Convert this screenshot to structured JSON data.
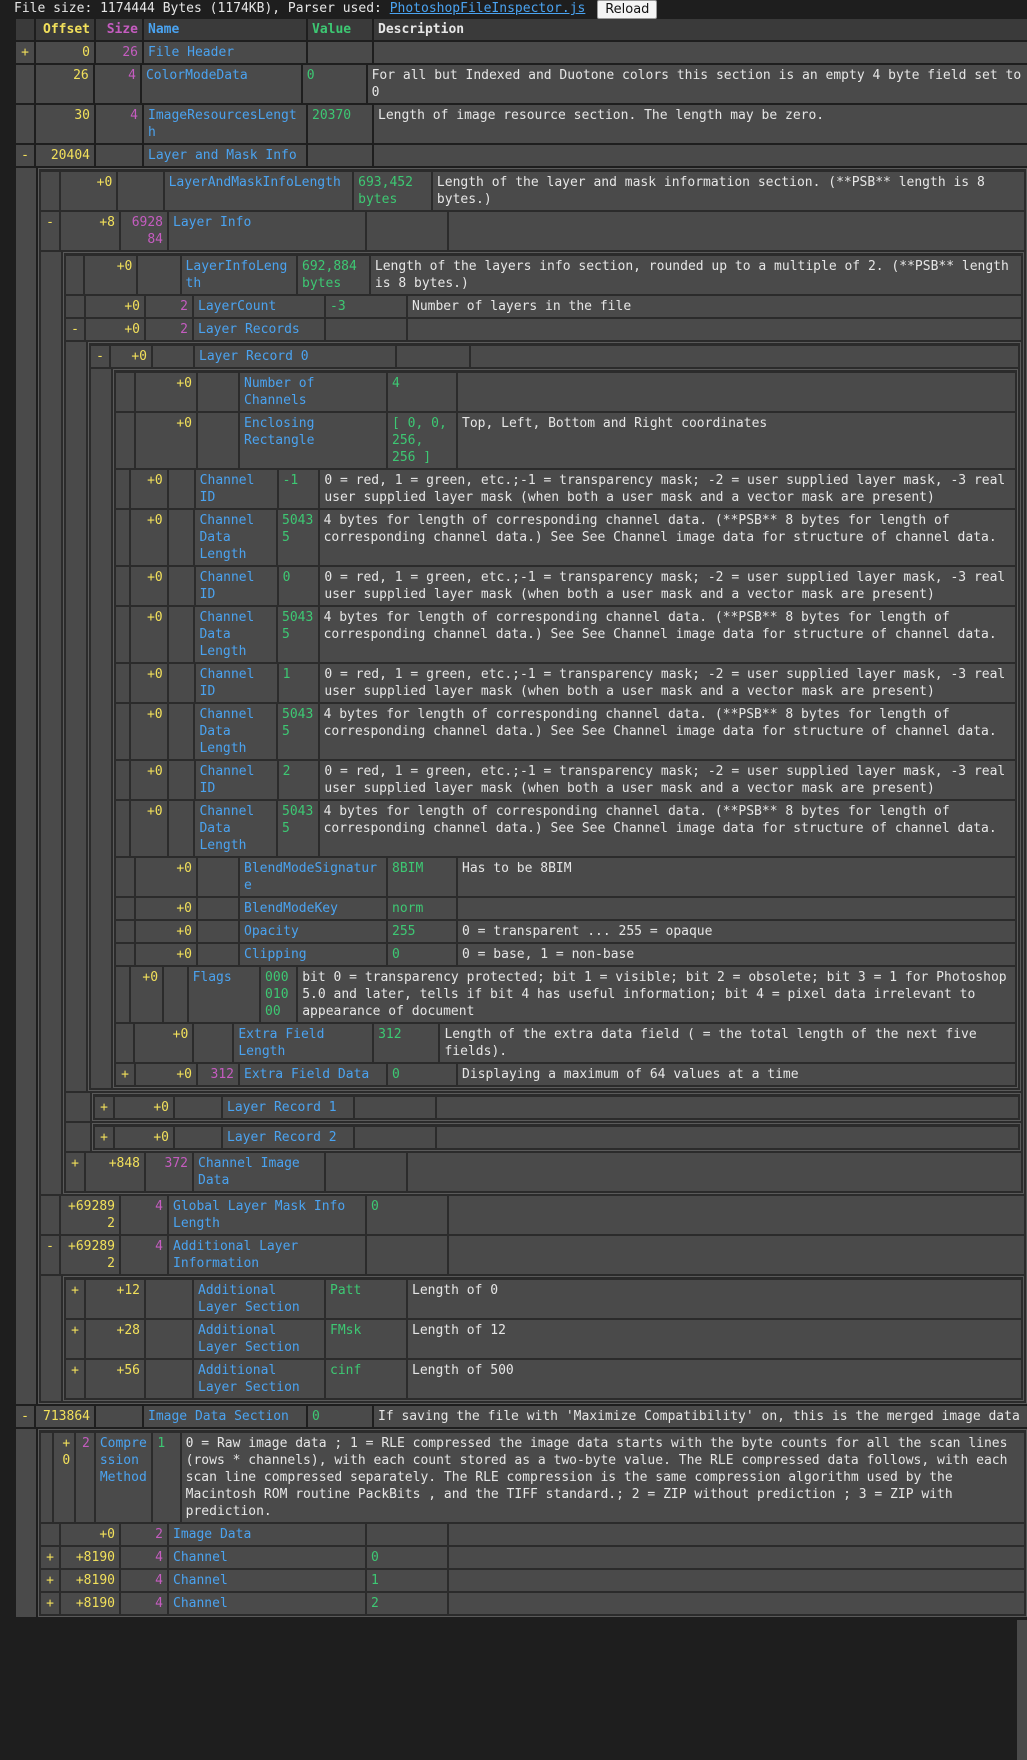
{
  "topbar": {
    "file_size_text": "File size: 1174444 Bytes (1174KB), Parser used:",
    "parser_link": "PhotoshopFileInspector.js",
    "reload_label": "Reload"
  },
  "headers": {
    "offset": "Offset",
    "size": "Size",
    "name": "Name",
    "value": "Value",
    "description": "Description"
  },
  "tree": [
    {
      "t": "+",
      "o": "0",
      "s": "26",
      "n": "File Header",
      "v": "",
      "d": ""
    },
    {
      "t": "",
      "o": "26",
      "s": "4",
      "n": "ColorModeData",
      "v": "0",
      "d": "For all but Indexed and Duotone colors this section is an empty 4 byte field set to 0"
    },
    {
      "t": "",
      "o": "30",
      "s": "4",
      "n": "ImageResourcesLength",
      "v": "20370",
      "d": "Length of image resource section. The length may be zero."
    },
    {
      "t": "-",
      "o": "20404",
      "s": "",
      "n": "Layer and Mask Info",
      "v": "",
      "d": "",
      "children": [
        {
          "t": "",
          "o": "+0",
          "s": "",
          "n": "LayerAndMaskInfoLength",
          "v": "693,452 bytes",
          "d": "Length of the layer and mask information section. (**PSB** length is 8 bytes.)"
        },
        {
          "t": "-",
          "o": "+8",
          "s": "692884",
          "n": "Layer Info",
          "v": "",
          "d": "",
          "children": [
            {
              "t": "",
              "o": "+0",
              "s": "",
              "n": "LayerInfoLength",
              "v": "692,884 bytes",
              "d": "Length of the layers info section, rounded up to a multiple of 2. (**PSB** length is 8 bytes.)"
            },
            {
              "t": "",
              "o": "+0",
              "s": "2",
              "n": "LayerCount",
              "v": "-3",
              "d": "Number of layers in the file"
            },
            {
              "t": "-",
              "o": "+0",
              "s": "2",
              "n": "Layer Records",
              "v": "",
              "d": "",
              "children": [
                {
                  "t": "-",
                  "o": "+0",
                  "s": "",
                  "n": "Layer Record 0",
                  "v": "",
                  "d": "",
                  "children": [
                    {
                      "t": "",
                      "o": "+0",
                      "s": "",
                      "n": "Number of Channels",
                      "v": "4",
                      "d": ""
                    },
                    {
                      "t": "",
                      "o": "+0",
                      "s": "",
                      "n": "Enclosing Rectangle",
                      "v": "[ 0, 0, 256, 256 ]",
                      "d": "Top, Left, Bottom and Right coordinates"
                    },
                    {
                      "t": "",
                      "o": "+0",
                      "s": "",
                      "n": "Channel ID",
                      "v": "-1",
                      "d": "0 = red, 1 = green, etc.;-1 = transparency mask; -2 = user supplied layer mask, -3 real user supplied layer mask (when both a user mask and a vector mask are present)"
                    },
                    {
                      "t": "",
                      "o": "+0",
                      "s": "",
                      "n": "Channel Data Length",
                      "v": "50435",
                      "d": "4 bytes for length of corresponding channel data. (**PSB** 8 bytes for length of corresponding channel data.) See See Channel image data for structure of channel data."
                    },
                    {
                      "t": "",
                      "o": "+0",
                      "s": "",
                      "n": "Channel ID",
                      "v": "0",
                      "d": "0 = red, 1 = green, etc.;-1 = transparency mask; -2 = user supplied layer mask, -3 real user supplied layer mask (when both a user mask and a vector mask are present)"
                    },
                    {
                      "t": "",
                      "o": "+0",
                      "s": "",
                      "n": "Channel Data Length",
                      "v": "50435",
                      "d": "4 bytes for length of corresponding channel data. (**PSB** 8 bytes for length of corresponding channel data.) See See Channel image data for structure of channel data."
                    },
                    {
                      "t": "",
                      "o": "+0",
                      "s": "",
                      "n": "Channel ID",
                      "v": "1",
                      "d": "0 = red, 1 = green, etc.;-1 = transparency mask; -2 = user supplied layer mask, -3 real user supplied layer mask (when both a user mask and a vector mask are present)"
                    },
                    {
                      "t": "",
                      "o": "+0",
                      "s": "",
                      "n": "Channel Data Length",
                      "v": "50435",
                      "d": "4 bytes for length of corresponding channel data. (**PSB** 8 bytes for length of corresponding channel data.) See See Channel image data for structure of channel data."
                    },
                    {
                      "t": "",
                      "o": "+0",
                      "s": "",
                      "n": "Channel ID",
                      "v": "2",
                      "d": "0 = red, 1 = green, etc.;-1 = transparency mask; -2 = user supplied layer mask, -3 real user supplied layer mask (when both a user mask and a vector mask are present)"
                    },
                    {
                      "t": "",
                      "o": "+0",
                      "s": "",
                      "n": "Channel Data Length",
                      "v": "50435",
                      "d": "4 bytes for length of corresponding channel data. (**PSB** 8 bytes for length of corresponding channel data.) See See Channel image data for structure of channel data."
                    },
                    {
                      "t": "",
                      "o": "+0",
                      "s": "",
                      "n": "BlendModeSignature",
                      "v": "8BIM",
                      "d": "Has to be 8BIM"
                    },
                    {
                      "t": "",
                      "o": "+0",
                      "s": "",
                      "n": "BlendModeKey",
                      "v": "norm",
                      "d": ""
                    },
                    {
                      "t": "",
                      "o": "+0",
                      "s": "",
                      "n": "Opacity",
                      "v": "255",
                      "d": "0 = transparent ... 255 = opaque"
                    },
                    {
                      "t": "",
                      "o": "+0",
                      "s": "",
                      "n": "Clipping",
                      "v": "0",
                      "d": "0 = base, 1 = non-base"
                    },
                    {
                      "t": "",
                      "o": "+0",
                      "s": "",
                      "n": "Flags",
                      "v": "00001000",
                      "d": "bit 0 = transparency protected; bit 1 = visible; bit 2 = obsolete; bit 3 = 1 for Photoshop 5.0 and later, tells if bit 4 has useful information; bit 4 = pixel data irrelevant to appearance of document"
                    },
                    {
                      "t": "",
                      "o": "+0",
                      "s": "",
                      "n": "Extra Field Length",
                      "v": "312",
                      "d": "Length of the extra data field ( = the total length of the next five fields)."
                    },
                    {
                      "t": "+",
                      "o": "+0",
                      "s": "312",
                      "n": "Extra Field Data",
                      "v": "0",
                      "d": "Displaying a maximum of 64 values at a time"
                    }
                  ]
                }
              ]
            },
            {
              "t": "+",
              "o": "+0",
              "s": "",
              "n": "Layer Record 1",
              "v": "",
              "d": "",
              "boxed": true
            },
            {
              "t": "+",
              "o": "+0",
              "s": "",
              "n": "Layer Record 2",
              "v": "",
              "d": "",
              "boxed": true
            },
            {
              "t": "+",
              "o": "+848",
              "s": "372",
              "n": "Channel Image Data",
              "v": "",
              "d": ""
            }
          ]
        },
        {
          "t": "",
          "o": "+692892",
          "s": "4",
          "n": "Global Layer Mask Info Length",
          "v": "0",
          "d": ""
        },
        {
          "t": "-",
          "o": "+692892",
          "s": "4",
          "n": "Additional Layer Information",
          "v": "",
          "d": "",
          "children": [
            {
              "t": "+",
              "o": "+12",
              "s": "",
              "n": "Additional Layer Section",
              "v": "Patt",
              "d": "Length of 0"
            },
            {
              "t": "+",
              "o": "+28",
              "s": "",
              "n": "Additional Layer Section",
              "v": "FMsk",
              "d": "Length of 12"
            },
            {
              "t": "+",
              "o": "+56",
              "s": "",
              "n": "Additional Layer Section",
              "v": "cinf",
              "d": "Length of 500"
            }
          ]
        }
      ]
    },
    {
      "t": "-",
      "o": "713864",
      "s": "",
      "n": "Image Data Section",
      "v": "0",
      "d": "If saving the file with 'Maximize Compatibility' on, this is the merged image data",
      "children": [
        {
          "t": "",
          "o": "+0",
          "s": "2",
          "n": "Compression Method",
          "v": "1",
          "d": "0 = Raw image data ; 1 = RLE compressed the image data starts with the byte counts for all the scan lines (rows * channels), with each count stored as a two-byte value. The RLE compressed data follows, with each scan line compressed separately. The RLE compression is the same compression algorithm used by the Macintosh ROM routine PackBits , and the TIFF standard.; 2 = ZIP without prediction ; 3 = ZIP with prediction."
        },
        {
          "t": "",
          "o": "+0",
          "s": "2",
          "n": "Image Data",
          "v": "",
          "d": ""
        },
        {
          "t": "+",
          "o": "+8190",
          "s": "4",
          "n": "Channel",
          "v": "0",
          "d": ""
        },
        {
          "t": "+",
          "o": "+8190",
          "s": "4",
          "n": "Channel",
          "v": "1",
          "d": ""
        },
        {
          "t": "+",
          "o": "+8190",
          "s": "4",
          "n": "Channel",
          "v": "2",
          "d": ""
        }
      ]
    }
  ]
}
